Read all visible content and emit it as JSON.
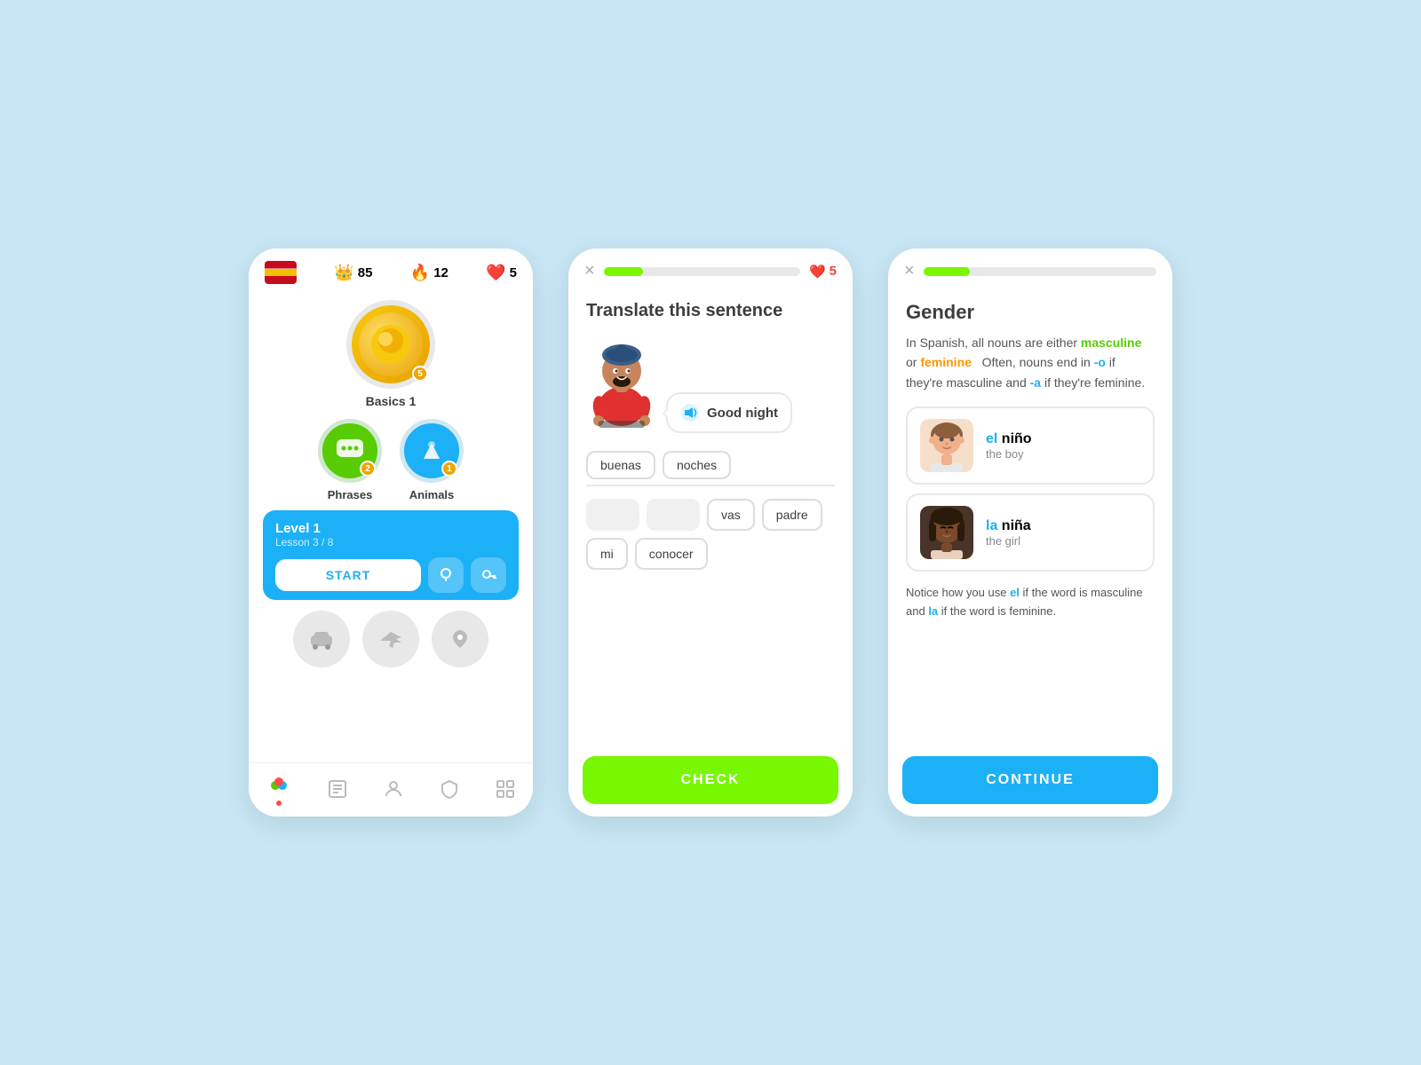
{
  "background": "#c8e6f5",
  "card1": {
    "flag": "🇪🇸",
    "stats": {
      "crown": {
        "icon": "👑",
        "value": "85"
      },
      "fire": {
        "icon": "🔥",
        "value": "12"
      },
      "heart": {
        "icon": "❤️",
        "value": "5"
      }
    },
    "basics": {
      "label": "Basics 1",
      "badge": "5",
      "emoji": "🟡"
    },
    "lessons": [
      {
        "label": "Phrases",
        "badge": "2",
        "color": "green",
        "emoji": "💬"
      },
      {
        "label": "Animals",
        "badge": "1",
        "color": "blue",
        "emoji": "🐟"
      }
    ],
    "level": {
      "title": "Level 1",
      "subtitle": "Lesson 3 / 8",
      "start_label": "START"
    },
    "locked": [
      "🚗",
      "✈️",
      "📍"
    ],
    "nav": [
      {
        "icon": "🔵",
        "active": true
      },
      {
        "icon": "📖",
        "active": false
      },
      {
        "icon": "🎓",
        "active": false
      },
      {
        "icon": "🛡",
        "active": false
      },
      {
        "icon": "📋",
        "active": false
      }
    ]
  },
  "card2": {
    "close_label": "×",
    "progress": 20,
    "hearts": "5",
    "title": "Translate this sentence",
    "character_speech": "Good night",
    "answer_chips": [
      "buenas",
      "noches"
    ],
    "word_bank": [
      {
        "word": "",
        "used": true
      },
      {
        "word": "",
        "used": true
      },
      {
        "word": "vas",
        "used": false
      },
      {
        "word": "padre",
        "used": false
      },
      {
        "word": "mi",
        "used": false
      },
      {
        "word": "conocer",
        "used": false
      }
    ],
    "check_label": "CHECK"
  },
  "card3": {
    "close_label": "×",
    "progress": 20,
    "title": "Gender",
    "description_parts": [
      {
        "text": "In Spanish, all nouns are either ",
        "type": "normal"
      },
      {
        "text": "masculine",
        "type": "masc"
      },
      {
        "text": " or ",
        "type": "normal"
      },
      {
        "text": "feminine",
        "type": "fem"
      },
      {
        "text": "  Often, nouns end in ",
        "type": "normal"
      },
      {
        "text": "-o",
        "type": "el"
      },
      {
        "text": " if they're masculine and ",
        "type": "normal"
      },
      {
        "text": "-a",
        "type": "el"
      },
      {
        "text": " if they're feminine.",
        "type": "normal"
      }
    ],
    "examples": [
      {
        "article": "el",
        "word": " niño",
        "translation": "the boy",
        "avatar_color": "#c8845a",
        "gender": "masc"
      },
      {
        "article": "la",
        "word": " niña",
        "translation": "the girl",
        "avatar_color": "#5a4030",
        "gender": "fem"
      }
    ],
    "notice": {
      "parts": [
        {
          "text": "Notice how you use ",
          "type": "normal"
        },
        {
          "text": "el",
          "type": "el"
        },
        {
          "text": " if the word is masculine and ",
          "type": "normal"
        },
        {
          "text": "la",
          "type": "el"
        },
        {
          "text": " if the word is feminine.",
          "type": "normal"
        }
      ]
    },
    "continue_label": "CONTINUE"
  }
}
